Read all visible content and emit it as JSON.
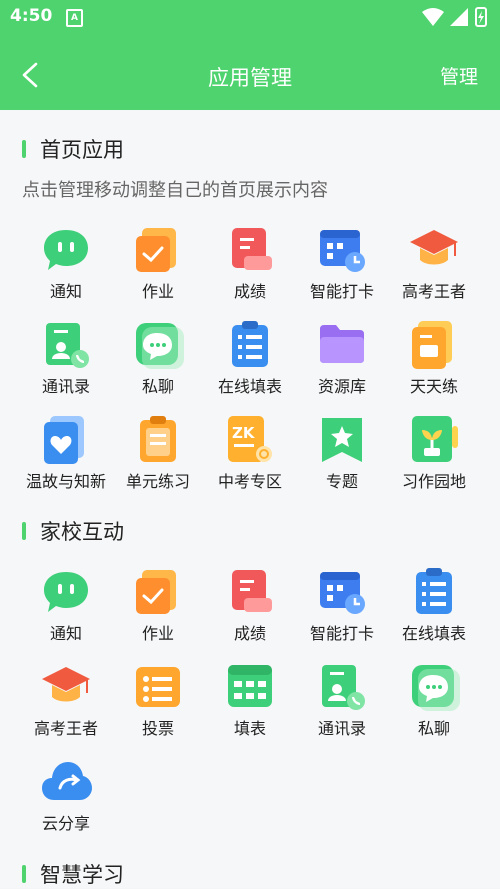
{
  "status_bar": {
    "time": "4:50"
  },
  "header": {
    "title": "应用管理",
    "manage_label": "管理"
  },
  "sections": [
    {
      "title": "首页应用",
      "hint": "点击管理移动调整自己的首页展示内容",
      "items": [
        {
          "label": "通知",
          "icon": "chat-bubble-icon"
        },
        {
          "label": "作业",
          "icon": "homework-icon"
        },
        {
          "label": "成绩",
          "icon": "grades-icon"
        },
        {
          "label": "智能打卡",
          "icon": "calendar-clock-icon"
        },
        {
          "label": "高考王者",
          "icon": "graduation-cap-icon"
        },
        {
          "label": "通讯录",
          "icon": "contacts-icon"
        },
        {
          "label": "私聊",
          "icon": "private-chat-icon"
        },
        {
          "label": "在线填表",
          "icon": "clipboard-list-icon"
        },
        {
          "label": "资源库",
          "icon": "folder-icon"
        },
        {
          "label": "天天练",
          "icon": "practice-book-icon"
        },
        {
          "label": "温故与知新",
          "icon": "heart-book-icon"
        },
        {
          "label": "单元练习",
          "icon": "unit-clipboard-icon"
        },
        {
          "label": "中考专区",
          "icon": "zk-icon"
        },
        {
          "label": "专题",
          "icon": "star-bookmark-icon"
        },
        {
          "label": "习作园地",
          "icon": "plant-card-icon"
        }
      ]
    },
    {
      "title": "家校互动",
      "items": [
        {
          "label": "通知",
          "icon": "chat-bubble-icon"
        },
        {
          "label": "作业",
          "icon": "homework-icon"
        },
        {
          "label": "成绩",
          "icon": "grades-icon"
        },
        {
          "label": "智能打卡",
          "icon": "calendar-clock-icon"
        },
        {
          "label": "在线填表",
          "icon": "clipboard-list-icon"
        },
        {
          "label": "高考王者",
          "icon": "graduation-cap-icon"
        },
        {
          "label": "投票",
          "icon": "vote-icon"
        },
        {
          "label": "填表",
          "icon": "table-form-icon"
        },
        {
          "label": "通讯录",
          "icon": "contacts-icon"
        },
        {
          "label": "私聊",
          "icon": "private-chat-icon"
        },
        {
          "label": "云分享",
          "icon": "cloud-share-icon"
        }
      ]
    },
    {
      "title": "智慧学习",
      "items": []
    }
  ]
}
